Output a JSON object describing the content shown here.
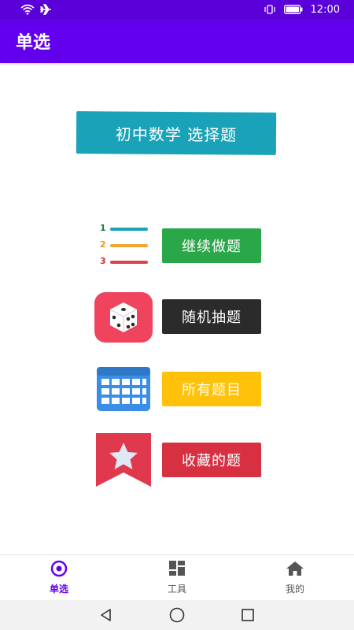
{
  "status_bar": {
    "time": "12:00"
  },
  "app_bar": {
    "title": "单选"
  },
  "main": {
    "banner": "初中数学 选择题",
    "list_numbers": [
      "1",
      "2",
      "3"
    ],
    "menu": [
      {
        "label": "继续做题",
        "color": "#2aa748",
        "icon": "numbered-list-icon"
      },
      {
        "label": "随机抽题",
        "color": "#2b2b2b",
        "icon": "dice-icon"
      },
      {
        "label": "所有题目",
        "color": "#ffc10a",
        "icon": "calendar-grid-icon"
      },
      {
        "label": "收藏的题",
        "color": "#d63041",
        "icon": "star-bookmark-icon"
      }
    ]
  },
  "bottom_nav": {
    "items": [
      {
        "label": "单选",
        "active": true,
        "icon": "radio-target-icon"
      },
      {
        "label": "工具",
        "active": false,
        "icon": "grid-tools-icon"
      },
      {
        "label": "我的",
        "active": false,
        "icon": "home-icon"
      }
    ]
  },
  "system_nav": {
    "buttons": [
      "back-icon",
      "home-circle-icon",
      "recents-icon"
    ]
  }
}
